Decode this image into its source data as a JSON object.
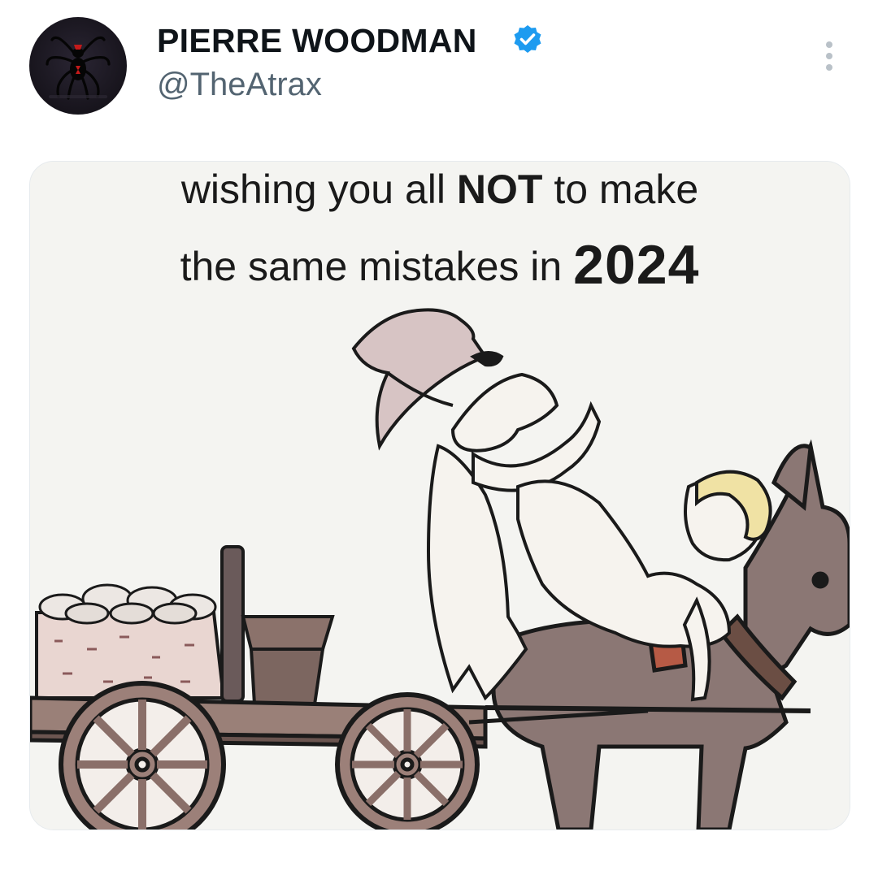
{
  "post": {
    "author": {
      "display_name": "PIERRE WOODMAN",
      "handle": "@TheAtrax",
      "verified": true,
      "avatar_icon": "black-widow-spider-icon"
    },
    "more_icon": "more-vertical-icon",
    "media": {
      "caption": {
        "line1_part1": "wishing you all ",
        "line1_emphasis": "NOT",
        "line1_part2": " to make",
        "line2_part1": "the same mistakes in ",
        "line2_year": "2024"
      },
      "illustration": "cartoon-donkey-cart-icon"
    }
  },
  "colors": {
    "verified_blue": "#1d9bf0",
    "handle_gray": "#536471",
    "text_dark": "#0f1419"
  }
}
